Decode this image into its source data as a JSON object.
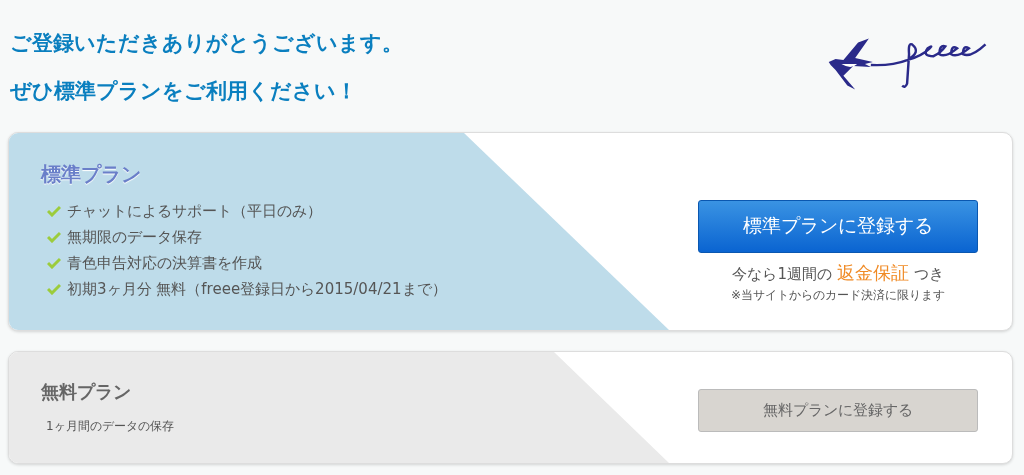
{
  "header": {
    "lines": [
      "ご登録いただきありがとうございます。",
      "ぜひ標準プランをご利用ください！"
    ]
  },
  "plans": [
    {
      "kind": "featured",
      "title": "標準プラン",
      "features": [
        "チャットによるサポート（平日のみ）",
        "無期限のデータ保存",
        "青色申告対応の決算書を作成",
        "初期3ヶ月分 無料（freee登録日から2015/04/21まで）"
      ],
      "button": "標準プランに登録する",
      "offer": {
        "before": "今なら1週間の",
        "highlight": "返金保証",
        "after": "つき"
      },
      "disclaimer": "※当サイトからのカード決済に限ります"
    },
    {
      "kind": "basic",
      "title": "無料プラン",
      "description": "1ヶ月間のデータの保存",
      "button": "無料プランに登録する"
    }
  ]
}
